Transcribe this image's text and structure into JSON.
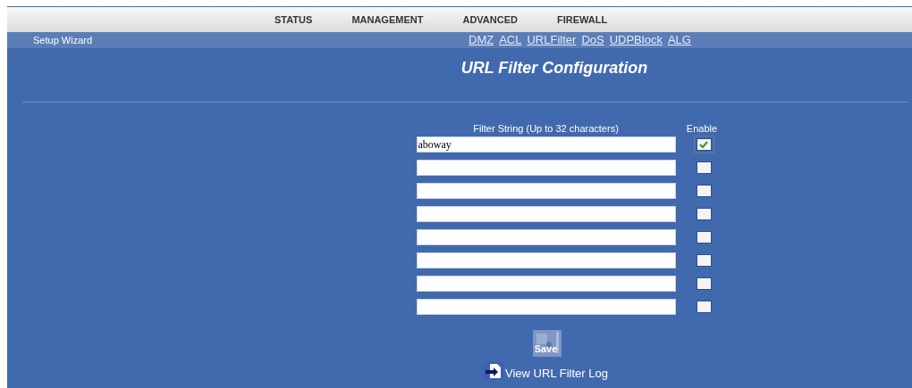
{
  "top_menu": [
    {
      "label": "STATUS"
    },
    {
      "label": "MANAGEMENT"
    },
    {
      "label": "ADVANCED"
    },
    {
      "label": "FIREWALL"
    }
  ],
  "setup_wizard": "Setup Wizard",
  "sub_menu": [
    {
      "label": "DMZ"
    },
    {
      "label": "ACL"
    },
    {
      "label": "URLFilter"
    },
    {
      "label": "DoS"
    },
    {
      "label": "UDPBlock"
    },
    {
      "label": "ALG"
    }
  ],
  "title": "URL Filter Configuration",
  "columns": [
    "Filter String (Up to 32 characters)",
    "Enable"
  ],
  "rows": [
    {
      "value": "aboway",
      "checked": true
    },
    {
      "value": "",
      "checked": false
    },
    {
      "value": "",
      "checked": false
    },
    {
      "value": "",
      "checked": false
    },
    {
      "value": "",
      "checked": false
    },
    {
      "value": "",
      "checked": false
    },
    {
      "value": "",
      "checked": false
    },
    {
      "value": "",
      "checked": false
    }
  ],
  "save": "Save",
  "log_link": "View URL Filter Log"
}
